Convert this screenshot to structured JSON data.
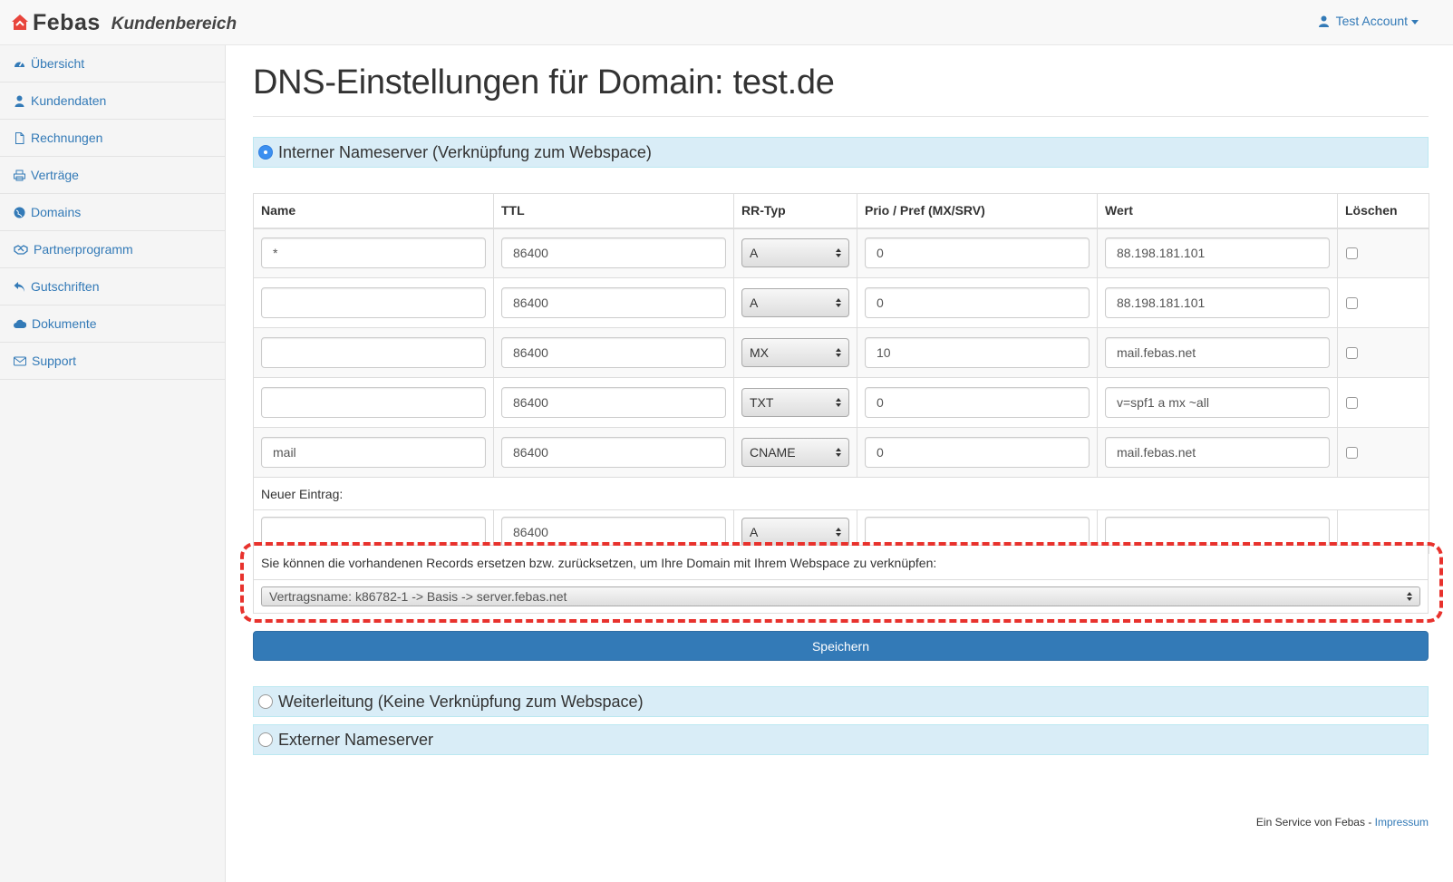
{
  "brand": {
    "name": "Febas",
    "subtitle": "Kundenbereich"
  },
  "account": {
    "label": "Test Account"
  },
  "sidebar": {
    "items": [
      {
        "label": "Übersicht",
        "icon": "dashboard-icon"
      },
      {
        "label": "Kundendaten",
        "icon": "user-icon"
      },
      {
        "label": "Rechnungen",
        "icon": "file-icon"
      },
      {
        "label": "Verträge",
        "icon": "print-icon"
      },
      {
        "label": "Domains",
        "icon": "globe-icon"
      },
      {
        "label": "Partnerprogramm",
        "icon": "handshake-icon"
      },
      {
        "label": "Gutschriften",
        "icon": "reply-icon"
      },
      {
        "label": "Dokumente",
        "icon": "cloud-icon"
      },
      {
        "label": "Support",
        "icon": "envelope-icon"
      }
    ]
  },
  "page": {
    "title": "DNS-Einstellungen für Domain: test.de"
  },
  "options": {
    "internal": {
      "label": "Interner Nameserver (Verknüpfung zum Webspace)",
      "checked": true
    },
    "redirect": {
      "label": "Weiterleitung (Keine Verknüpfung zum Webspace)",
      "checked": false
    },
    "external": {
      "label": "Externer Nameserver",
      "checked": false
    }
  },
  "table": {
    "headers": {
      "name": "Name",
      "ttl": "TTL",
      "rrtype": "RR-Typ",
      "prio": "Prio / Pref (MX/SRV)",
      "value": "Wert",
      "delete": "Löschen"
    },
    "records": [
      {
        "name": "*",
        "ttl": "86400",
        "type": "A",
        "prio": "0",
        "value": "88.198.181.101"
      },
      {
        "name": "",
        "ttl": "86400",
        "type": "A",
        "prio": "0",
        "value": "88.198.181.101"
      },
      {
        "name": "",
        "ttl": "86400",
        "type": "MX",
        "prio": "10",
        "value": "mail.febas.net"
      },
      {
        "name": "",
        "ttl": "86400",
        "type": "TXT",
        "prio": "0",
        "value": "v=spf1 a mx ~all"
      },
      {
        "name": "mail",
        "ttl": "86400",
        "type": "CNAME",
        "prio": "0",
        "value": "mail.febas.net"
      }
    ],
    "new_label": "Neuer Eintrag:",
    "new_entry": {
      "name": "",
      "ttl": "86400",
      "type": "A",
      "prio": "",
      "value": ""
    }
  },
  "reset": {
    "text": "Sie können die vorhandenen Records ersetzen bzw. zurücksetzen, um Ihre Domain mit Ihrem Webspace zu verknüpfen:",
    "selected": "Vertragsname: k86782-1 -> Basis -> server.febas.net"
  },
  "save_label": "Speichern",
  "footer": {
    "text": "Ein Service von Febas - ",
    "link": "Impressum"
  },
  "colors": {
    "primary": "#337ab7",
    "info_bg": "#d9edf7",
    "highlight": "#e8322d"
  }
}
